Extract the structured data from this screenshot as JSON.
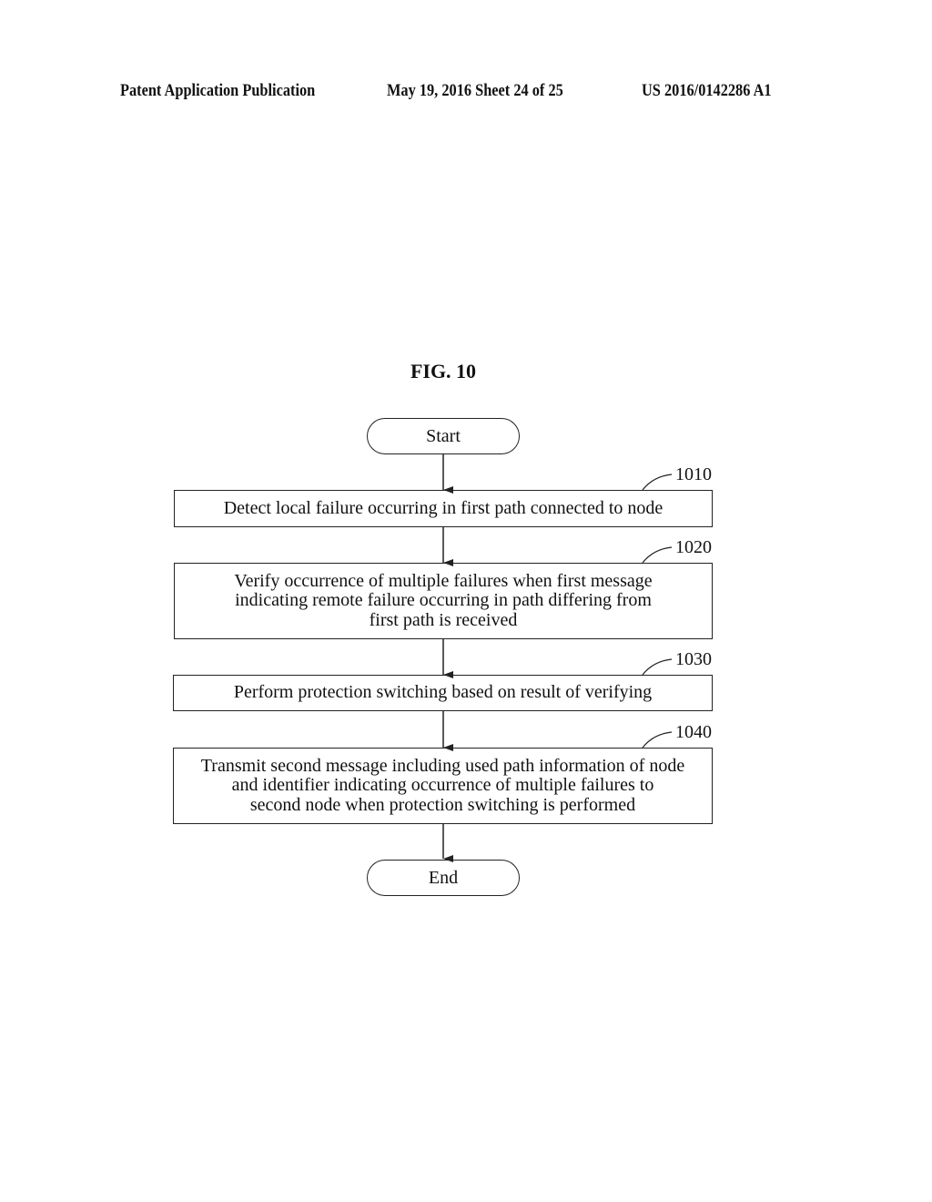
{
  "header": {
    "publication": "Patent Application Publication",
    "date_sheet": "May 19, 2016  Sheet 24 of 25",
    "number": "US 2016/0142286 A1"
  },
  "figure": {
    "title": "FIG. 10",
    "start_label": "Start",
    "end_label": "End",
    "steps": [
      {
        "ref": "1010",
        "lines": [
          "Detect local failure occurring in first path connected to node"
        ]
      },
      {
        "ref": "1020",
        "lines": [
          "Verify occurrence of multiple failures when first message",
          "indicating remote failure occurring in path differing from",
          "first path is received"
        ]
      },
      {
        "ref": "1030",
        "lines": [
          "Perform protection switching based on result of verifying"
        ]
      },
      {
        "ref": "1040",
        "lines": [
          "Transmit second message including used path information of node",
          "and identifier indicating occurrence of multiple failures to",
          "second node when protection switching is performed"
        ]
      }
    ]
  }
}
